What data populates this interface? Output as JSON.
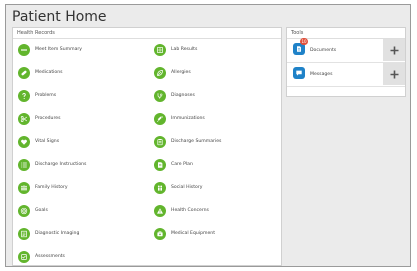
{
  "page": {
    "title": "Patient Home"
  },
  "health_records": {
    "title": "Health Records",
    "icon_color": "#62b52d",
    "items": [
      {
        "label": "Meet Item Summary",
        "icon": "dots-icon"
      },
      {
        "label": "Lab Results",
        "icon": "lab-grid-icon"
      },
      {
        "label": "Medications",
        "icon": "pill-icon"
      },
      {
        "label": "Allergies",
        "icon": "leaf-icon"
      },
      {
        "label": "Problems",
        "icon": "question-icon"
      },
      {
        "label": "Diagnoses",
        "icon": "stethoscope-icon"
      },
      {
        "label": "Procedures",
        "icon": "scissors-icon"
      },
      {
        "label": "Immunizations",
        "icon": "syringe-icon"
      },
      {
        "label": "Vital Signs",
        "icon": "heart-icon"
      },
      {
        "label": "Discharge Summaries",
        "icon": "clipboard-icon"
      },
      {
        "label": "Discharge Instructions",
        "icon": "list-icon"
      },
      {
        "label": "Care Plan",
        "icon": "care-plan-icon"
      },
      {
        "label": "Family History",
        "icon": "family-icon"
      },
      {
        "label": "Social History",
        "icon": "people-icon"
      },
      {
        "label": "Goals",
        "icon": "target-icon"
      },
      {
        "label": "Health Concerns",
        "icon": "warning-icon"
      },
      {
        "label": "Diagnostic Imaging",
        "icon": "imaging-icon"
      },
      {
        "label": "Medical Equipment",
        "icon": "equipment-icon"
      },
      {
        "label": "Assessments",
        "icon": "assessment-icon"
      }
    ]
  },
  "tools": {
    "title": "Tools",
    "icon_color": "#1f82c8",
    "items": [
      {
        "label": "Documents",
        "icon": "document-icon",
        "badge": "10",
        "add": "plus-icon"
      },
      {
        "label": "Messages",
        "icon": "message-icon",
        "add": "plus-icon"
      }
    ]
  }
}
